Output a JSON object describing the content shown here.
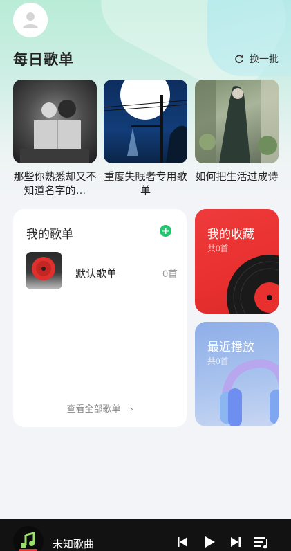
{
  "header": {
    "avatar_icon": "user-icon",
    "section_title": "每日歌单",
    "refresh_label": "换一批",
    "refresh_icon": "refresh-icon"
  },
  "daily_playlists": [
    {
      "title": "那些你熟悉却又不知道名字的…",
      "cover": "girl-reading-photo"
    },
    {
      "title": "重度失眠者专用歌单",
      "cover": "moon-streetlight-photo"
    },
    {
      "title": "如何把生活过成诗",
      "cover": "forest-figure-illustration"
    }
  ],
  "my_playlists": {
    "title": "我的歌单",
    "add_icon": "plus-circle-icon",
    "items": [
      {
        "name": "默认歌单",
        "count": "0首"
      }
    ],
    "view_all_label": "查看全部歌单"
  },
  "favorites": {
    "title": "我的收藏",
    "count": "共0首",
    "color": "#e8302f"
  },
  "recent": {
    "title": "最近播放",
    "count": "共0首",
    "color": "#9fb9ec"
  },
  "player": {
    "song_title": "未知歌曲",
    "controls": [
      "previous-icon",
      "play-icon",
      "next-icon",
      "playlist-icon"
    ]
  },
  "colors": {
    "accent": "#23c46e",
    "bg": "#f3f4f8"
  }
}
